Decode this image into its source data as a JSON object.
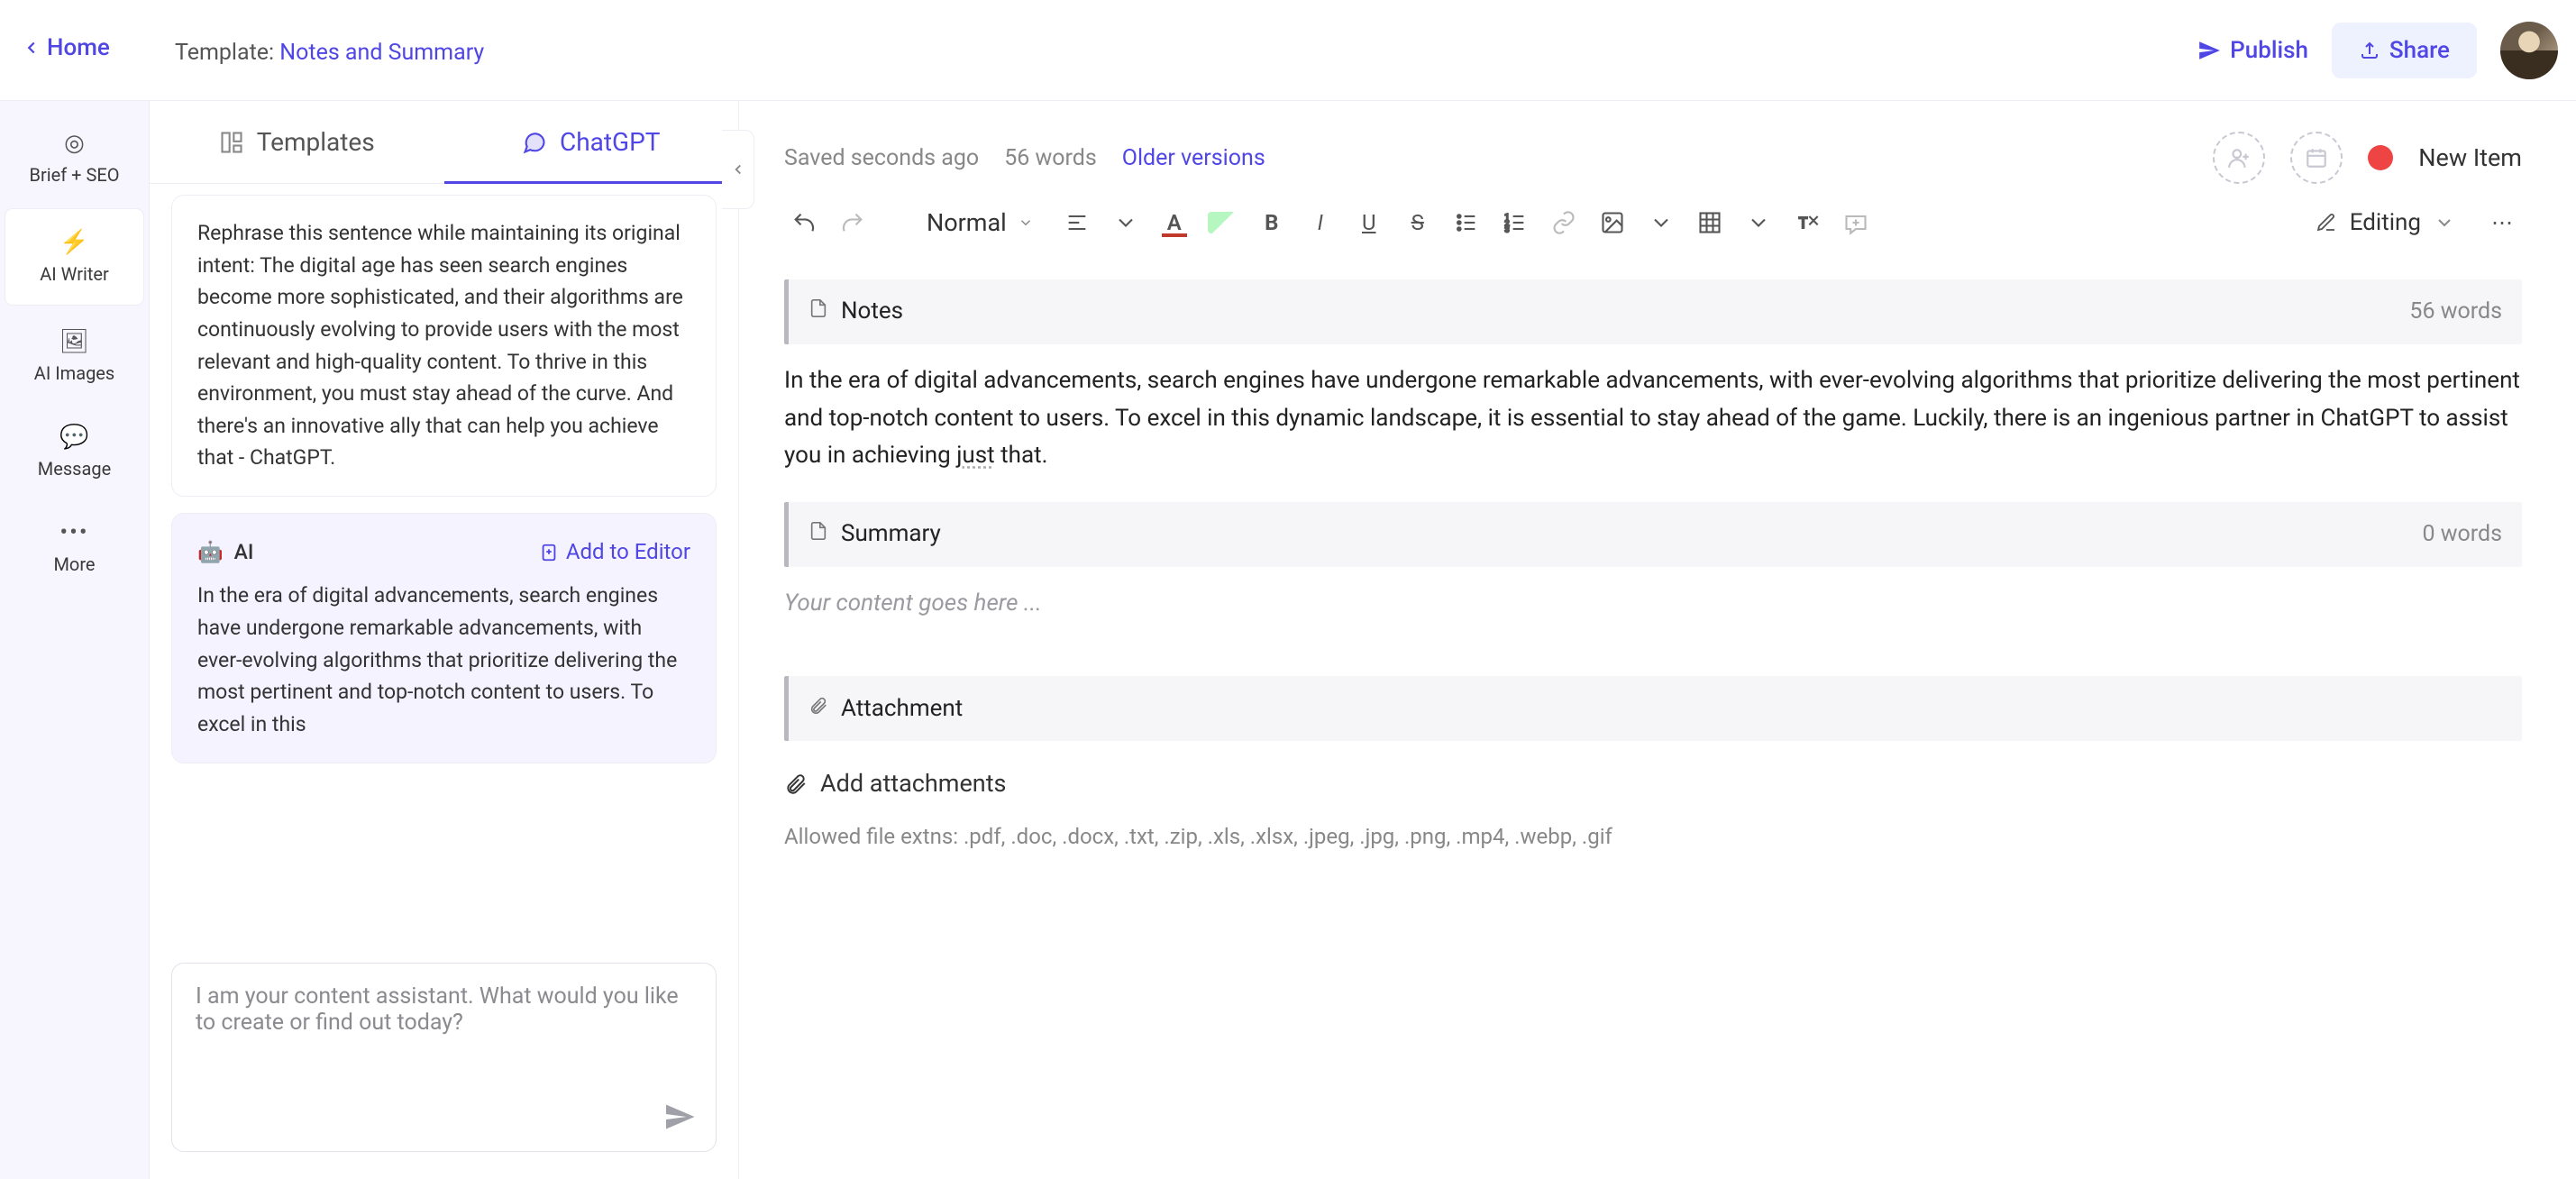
{
  "header": {
    "home": "Home",
    "template_prefix": "Template: ",
    "template_name": "Notes and Summary",
    "publish": "Publish",
    "share": "Share"
  },
  "vnav": {
    "brief": "Brief + SEO",
    "writer": "AI Writer",
    "images": "AI Images",
    "message": "Message",
    "more": "More"
  },
  "midpanel": {
    "tab_templates": "Templates",
    "tab_chatgpt": "ChatGPT",
    "user_prompt": "Rephrase this sentence while maintaining its original intent: The digital age has seen search engines become more sophisticated, and their algorithms are continuously evolving to provide users with the most relevant and high-quality content. To thrive in this environment, you must stay ahead of the curve. And there's an innovative ally that can help you achieve that - ChatGPT.",
    "ai_label": "AI",
    "add_to_editor": "Add to Editor",
    "ai_response": "In the era of digital advancements, search engines have undergone remarkable advancements, with ever-evolving algorithms that prioritize delivering the most pertinent and top-notch content to users. To excel in this",
    "input_placeholder": "I am your content assistant. What would you like to create or find out today?"
  },
  "editor": {
    "saved": "Saved seconds ago",
    "word_count": "56 words",
    "older": "Older versions",
    "new_item": "New Item",
    "format": "Normal",
    "mode": "Editing",
    "blocks": {
      "notes_title": "Notes",
      "notes_meta": "56 words",
      "notes_body_1": "In the era of digital advancements, search engines have undergone remarkable advancements, with ever-evolving algorithms that prioritize delivering the most pertinent and top-notch content to users. To excel in this dynamic landscape, it is essential to stay ahead of the game. Luckily, there is an ingenious partner in ChatGPT to assist you in achieving ",
      "notes_just": "just",
      "notes_body_2": " that.",
      "summary_title": "Summary",
      "summary_meta": "0 words",
      "summary_placeholder": "Your content goes here ...",
      "attach_title": "Attachment",
      "add_attachments": "Add attachments",
      "attach_hint": "Allowed file extns: .pdf, .doc, .docx, .txt, .zip, .xls, .xlsx, .jpeg, .jpg, .png, .mp4, .webp, .gif"
    }
  }
}
